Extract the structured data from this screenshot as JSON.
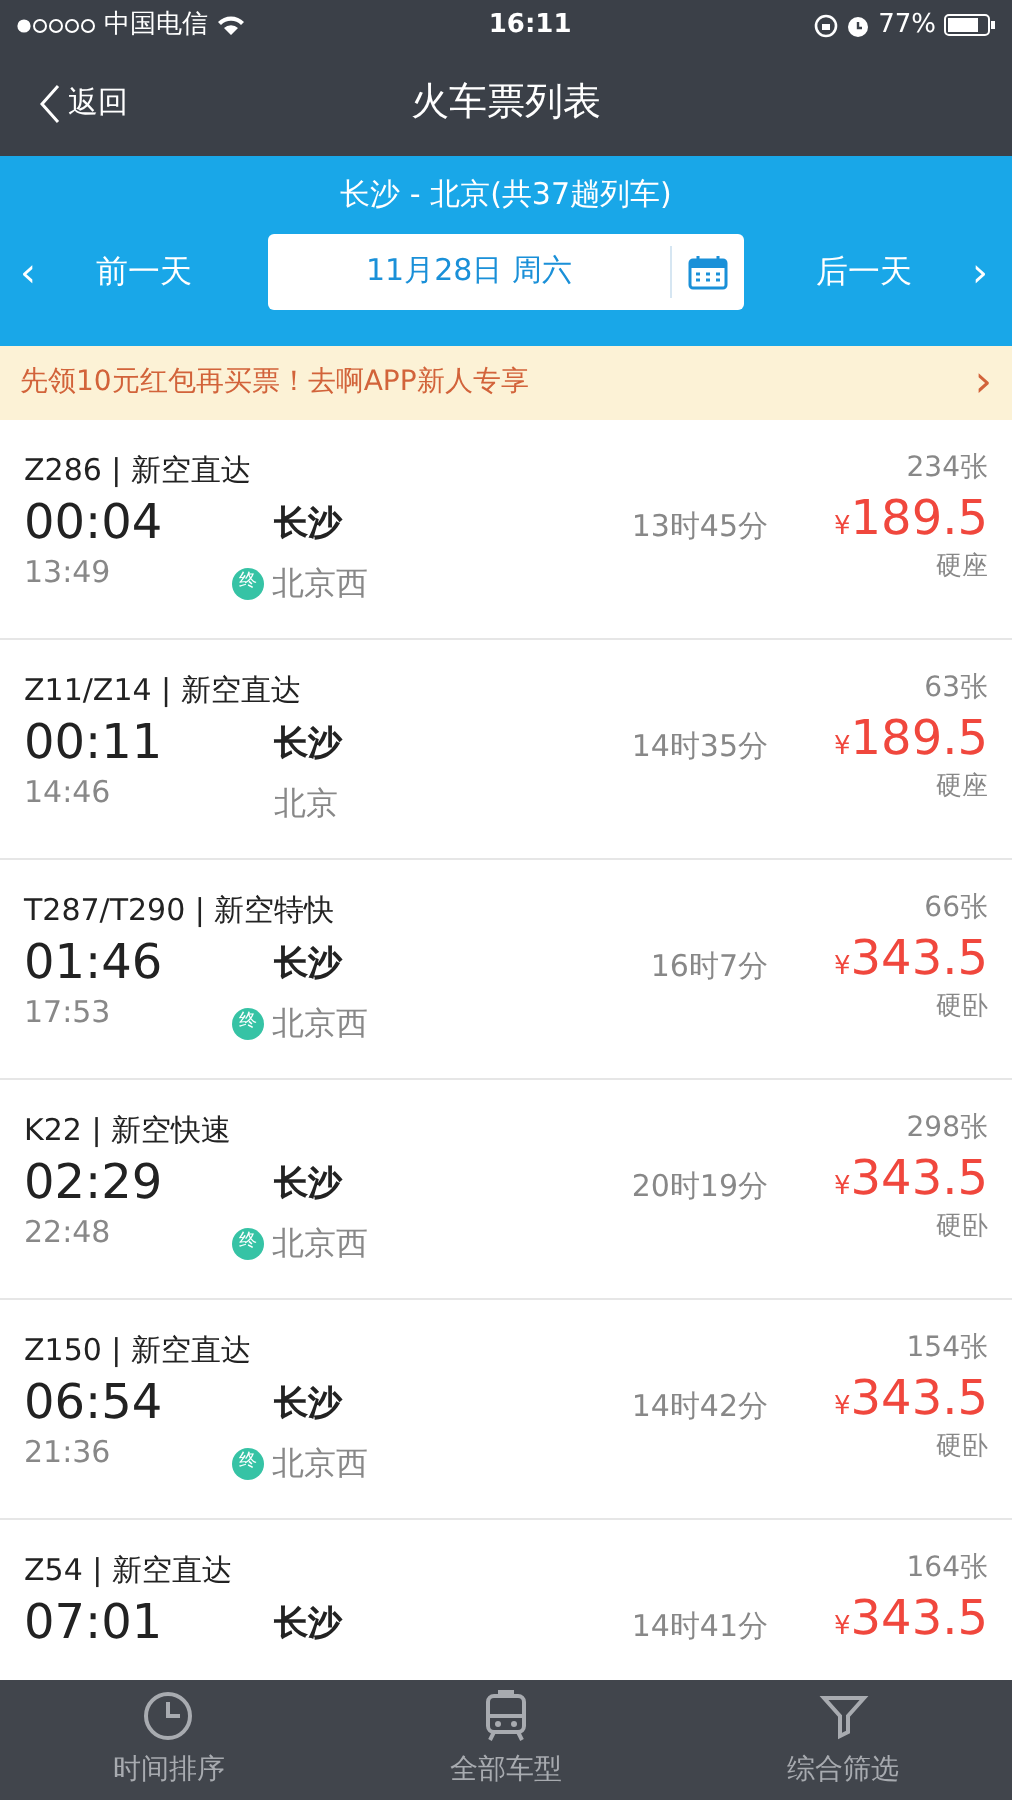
{
  "status_bar": {
    "carrier": "中国电信",
    "time": "16:11",
    "battery": "77%"
  },
  "nav": {
    "back": "返回",
    "title": "火车票列表"
  },
  "route": {
    "summary": "长沙 - 北京(共37趟列车)",
    "prev_arrow": "‹",
    "prev": "前一天",
    "date": "11月28日 周六",
    "next": "后一天",
    "next_arrow": "›"
  },
  "promo": {
    "text": "先领10元红包再买票！去啊APP新人专享",
    "arrow": "›"
  },
  "trains": [
    {
      "train": "Z286 | 新空直达",
      "depart": "00:04",
      "arrive": "13:49",
      "from": "长沙",
      "to": "北京西",
      "badge": "终",
      "duration": "13时45分",
      "currency": "¥",
      "price": "189.5",
      "tickets": "234张",
      "seat": "硬座"
    },
    {
      "train": "Z11/Z14 | 新空直达",
      "depart": "00:11",
      "arrive": "14:46",
      "from": "长沙",
      "to": "北京",
      "duration": "14时35分",
      "currency": "¥",
      "price": "189.5",
      "tickets": "63张",
      "seat": "硬座"
    },
    {
      "train": "T287/T290 | 新空特快",
      "depart": "01:46",
      "arrive": "17:53",
      "from": "长沙",
      "to": "北京西",
      "badge": "终",
      "duration": "16时7分",
      "currency": "¥",
      "price": "343.5",
      "tickets": "66张",
      "seat": "硬卧"
    },
    {
      "train": "K22 | 新空快速",
      "depart": "02:29",
      "arrive": "22:48",
      "from": "长沙",
      "to": "北京西",
      "badge": "终",
      "duration": "20时19分",
      "currency": "¥",
      "price": "343.5",
      "tickets": "298张",
      "seat": "硬卧"
    },
    {
      "train": "Z150 | 新空直达",
      "depart": "06:54",
      "arrive": "21:36",
      "from": "长沙",
      "to": "北京西",
      "badge": "终",
      "duration": "14时42分",
      "currency": "¥",
      "price": "343.5",
      "tickets": "154张",
      "seat": "硬卧"
    },
    {
      "train": "Z54 | 新空直达",
      "depart": "07:01",
      "from": "长沙",
      "duration": "14时41分",
      "currency": "¥",
      "price": "343.5",
      "tickets": "164张"
    }
  ],
  "tab_bar": [
    {
      "kind": "clock",
      "label": "时间排序"
    },
    {
      "kind": "train",
      "label": "全部车型"
    },
    {
      "kind": "filter",
      "label": "综合筛选"
    }
  ]
}
